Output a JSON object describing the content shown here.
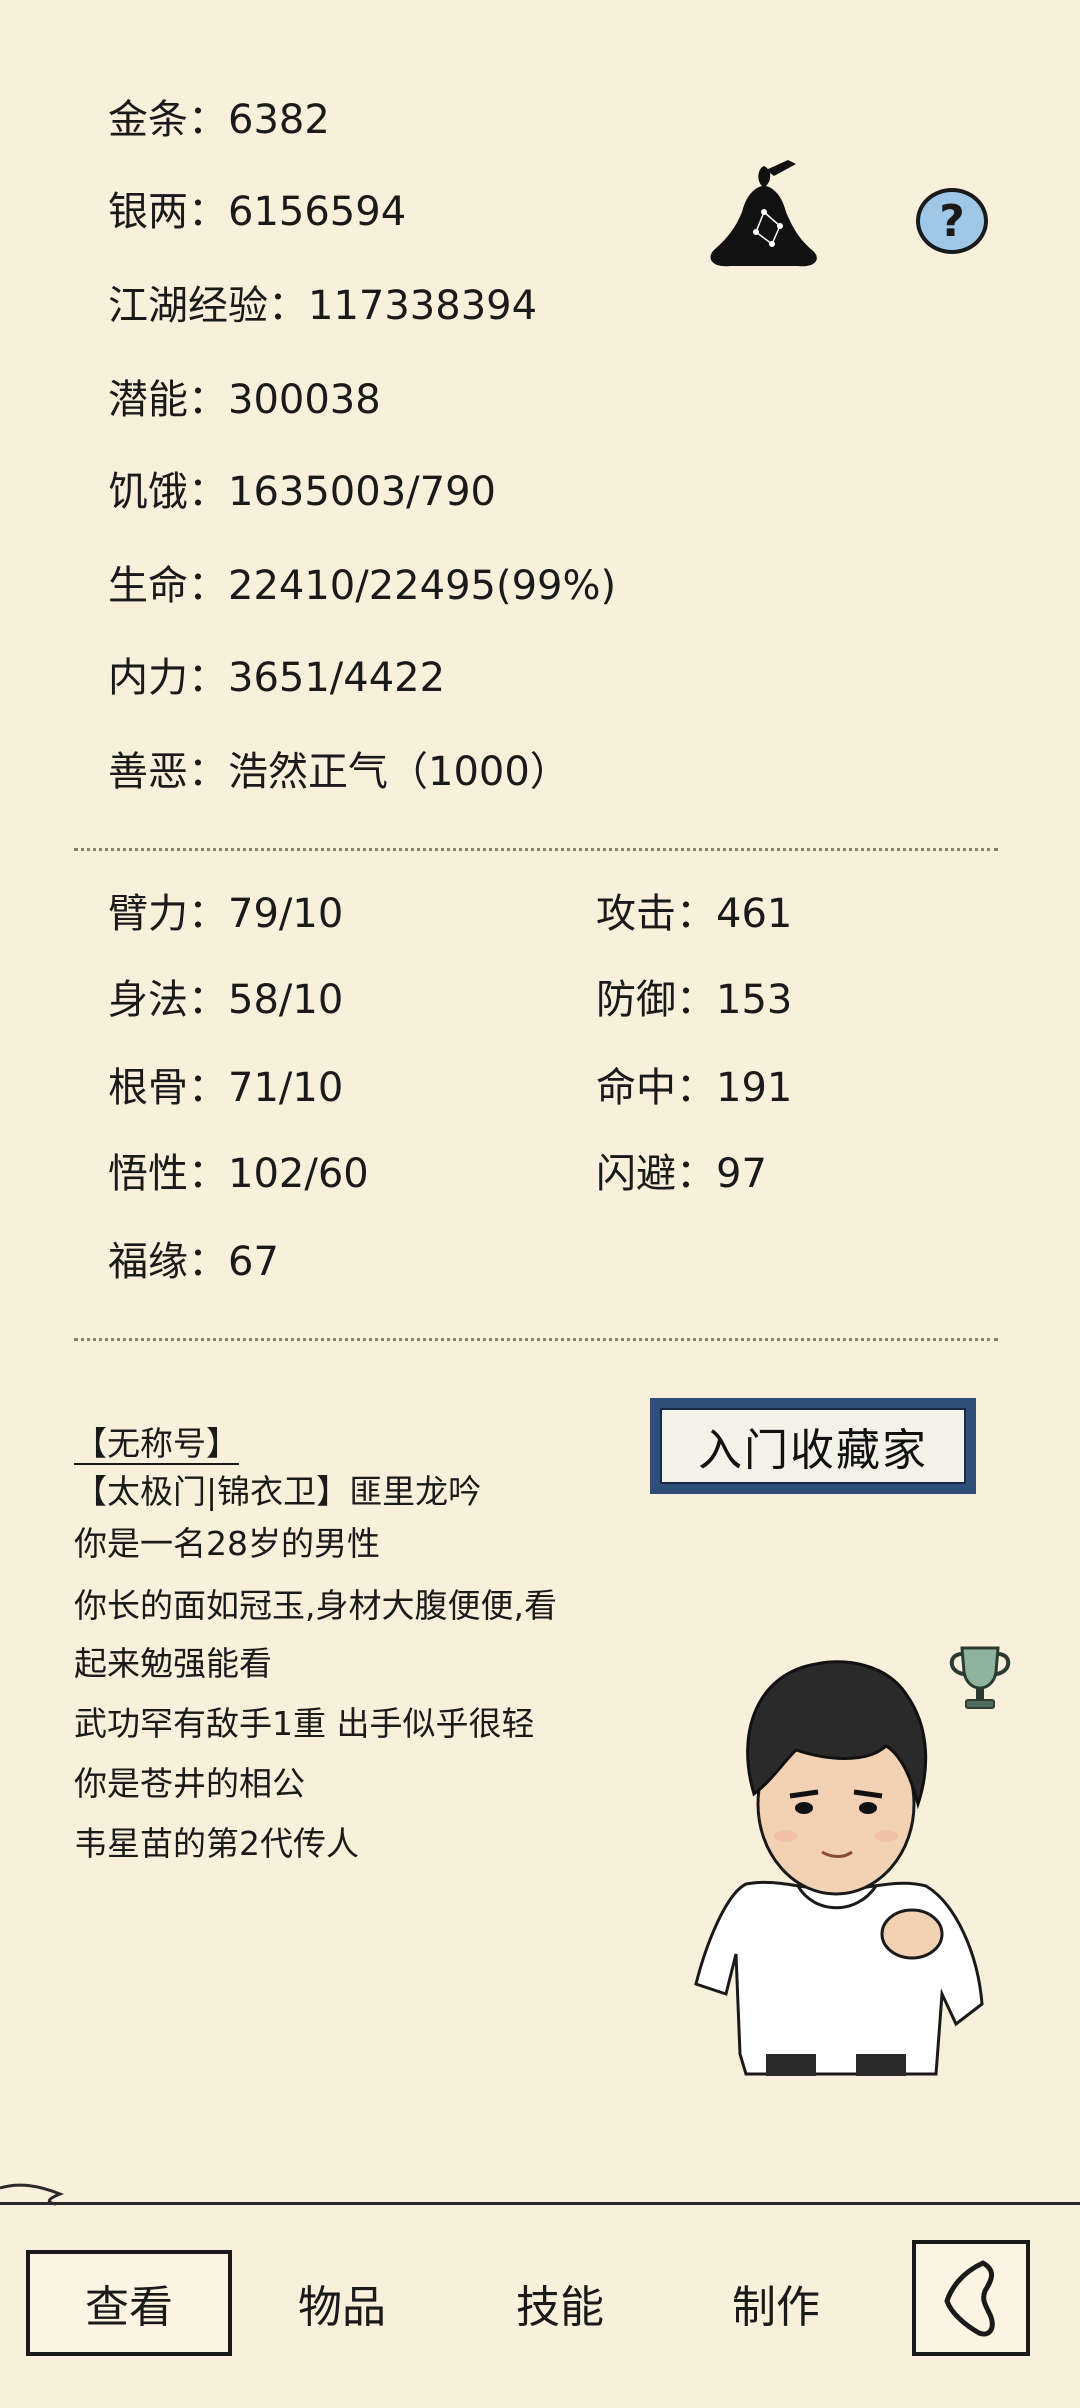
{
  "stats": [
    {
      "label": "金条：",
      "value": "6382"
    },
    {
      "label": "银两：",
      "value": "6156594"
    },
    {
      "label": "江湖经验：",
      "value": "117338394"
    },
    {
      "label": "潜能：",
      "value": "300038"
    },
    {
      "label": "饥饿：",
      "value": "1635003/790"
    },
    {
      "label": "生命：",
      "value": "22410/22495(99%)"
    },
    {
      "label": "内力：",
      "value": "3651/4422"
    },
    {
      "label": "善恶：",
      "value": "浩然正气（1000）"
    }
  ],
  "attributes_left": [
    {
      "label": "臂力：",
      "value": "79/10"
    },
    {
      "label": "身法：",
      "value": "58/10"
    },
    {
      "label": "根骨：",
      "value": "71/10"
    },
    {
      "label": "悟性：",
      "value": "102/60"
    },
    {
      "label": "福缘：",
      "value": "67"
    }
  ],
  "attributes_right": [
    {
      "label": "攻击：",
      "value": "461"
    },
    {
      "label": "防御：",
      "value": "153"
    },
    {
      "label": "命中：",
      "value": "191"
    },
    {
      "label": "闪避：",
      "value": "97"
    }
  ],
  "help_label": "?",
  "profile": {
    "title": "【无称号】",
    "lines": [
      "【太极门|锦衣卫】匪里龙吟",
      "你是一名28岁的男性",
      "你长的面如冠玉,身材大腹便便,看",
      "起来勉强能看",
      "武功罕有敌手1重 出手似乎很轻",
      "你是苍井的相公",
      "韦星苗的第2代传人"
    ],
    "badge": "入门收藏家"
  },
  "nav": {
    "tabs": [
      "查看",
      "物品",
      "技能",
      "制作"
    ]
  },
  "icons": [
    "meditation-silhouette-icon",
    "help-icon",
    "trophy-icon",
    "character-avatar",
    "back-icon"
  ]
}
